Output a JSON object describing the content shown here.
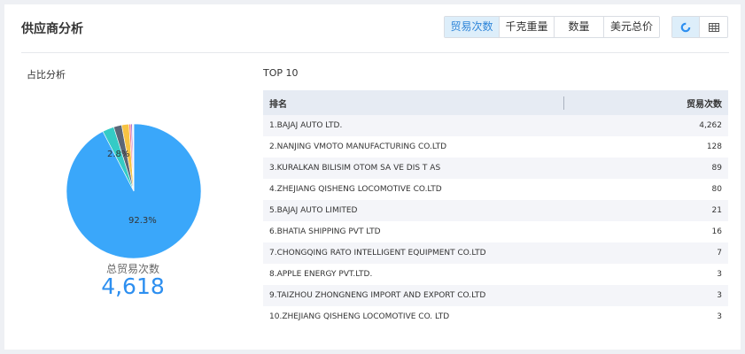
{
  "header": {
    "title": "供应商分析",
    "tabs": [
      {
        "label": "贸易次数",
        "active": true
      },
      {
        "label": "千克重量",
        "active": false
      },
      {
        "label": "数量",
        "active": false
      },
      {
        "label": "美元总价",
        "active": false
      }
    ],
    "view_buttons": [
      {
        "icon": "pie-chart-icon",
        "active": true
      },
      {
        "icon": "table-grid-icon",
        "active": false
      }
    ]
  },
  "left": {
    "subtitle": "占比分析",
    "total_label": "总贸易次数",
    "total_value": "4,618"
  },
  "right": {
    "subtitle": "TOP 10",
    "columns": [
      "排名",
      "贸易次数"
    ],
    "rows": [
      {
        "name": "1.BAJAJ AUTO LTD.",
        "value": "4,262"
      },
      {
        "name": "2.NANJING VMOTO MANUFACTURING CO.LTD",
        "value": "128"
      },
      {
        "name": "3.KURALKAN BILISIM OTOM SA VE DIS T AS",
        "value": "89"
      },
      {
        "name": "4.ZHEJIANG QISHENG LOCOMOTIVE CO.LTD",
        "value": "80"
      },
      {
        "name": "5.BAJAJ AUTO LIMITED",
        "value": "21"
      },
      {
        "name": "6.BHATIA SHIPPING PVT LTD",
        "value": "16"
      },
      {
        "name": "7.CHONGQING RATO INTELLIGENT EQUIPMENT CO.LTD",
        "value": "7"
      },
      {
        "name": "8.APPLE ENERGY PVT.LTD.",
        "value": "3"
      },
      {
        "name": "9.TAIZHOU ZHONGNENG IMPORT AND EXPORT CO.LTD",
        "value": "3"
      },
      {
        "name": "10.ZHEJIANG QISHENG LOCOMOTIVE CO. LTD",
        "value": "3"
      }
    ]
  },
  "chart_data": {
    "type": "pie",
    "slice_labels": [
      "92.3%",
      "2.8%"
    ],
    "values": [
      4262,
      128,
      89,
      80,
      21,
      16,
      7,
      3,
      3,
      3
    ],
    "colors": [
      "#3aa7fa",
      "#34cbc6",
      "#5c6677",
      "#f6c343",
      "#f47a8a",
      "#a66bd3",
      "#68c98b",
      "#f8a15b",
      "#7c8fe6",
      "#c9cdd6"
    ]
  },
  "colors": {
    "accent": "#2d8ff0",
    "active_tab_bg": "#ddeefa",
    "header_row_bg": "#e6ebf3",
    "alt_row_bg": "#f4f5f9"
  }
}
